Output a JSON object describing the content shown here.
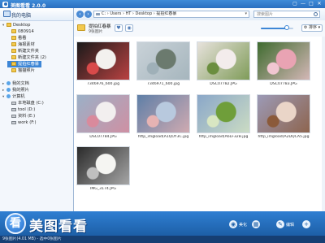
{
  "window": {
    "title": "美图看看 2.0.0",
    "buttons": [
      "▢",
      "—",
      "□",
      "✕"
    ]
  },
  "sidebar": {
    "computer_label": "我的电脑",
    "tree": [
      {
        "label": "Desktop",
        "icon": "folder",
        "expanded": true
      },
      {
        "label": "080914",
        "icon": "folder"
      },
      {
        "label": "看看",
        "icon": "folder"
      },
      {
        "label": "海报素材",
        "icon": "folder"
      },
      {
        "label": "新建文件夹",
        "icon": "folder"
      },
      {
        "label": "新建文件夹 (2)",
        "icon": "folder"
      },
      {
        "label": "提拍红春暴",
        "icon": "folder",
        "selected": true
      },
      {
        "label": "猫猫照片",
        "icon": "folder"
      },
      {
        "label": "我的文档",
        "icon": "special"
      },
      {
        "label": "我的照片",
        "icon": "special"
      },
      {
        "label": "计算机",
        "icon": "special",
        "expanded": true
      },
      {
        "label": "本地磁盘 (C:)",
        "icon": "drive"
      },
      {
        "label": "tool (D:)",
        "icon": "drive"
      },
      {
        "label": "资料 (E:)",
        "icon": "drive"
      },
      {
        "label": "work (F:)",
        "icon": "drive"
      }
    ]
  },
  "toolbar": {
    "back_icon": "‹",
    "forward_icon": "›",
    "address": "C: › Users › HT › Desktop › 提拍红春暴",
    "search_placeholder": "搜索图片"
  },
  "folder_header": {
    "name": "提拍红春暴",
    "count": "9张图片",
    "sort_label": "排序",
    "zoom_level": 0.8
  },
  "thumbnails": [
    {
      "caption": "7346976_600.jpg",
      "palette": [
        "#1a1a1a",
        "#f3f1ee",
        "#d94a4a"
      ]
    },
    {
      "caption": "7346971_600.jpg",
      "palette": [
        "#c9d2d8",
        "#6b7a6e",
        "#9fb0b8"
      ]
    },
    {
      "caption": "DSC07782.JPG",
      "palette": [
        "#e7e2dc",
        "#f3ecec",
        "#6b8e3f"
      ]
    },
    {
      "caption": "DSC07783.JPG",
      "palette": [
        "#3f6b2f",
        "#e9a3b3",
        "#f1c6d1"
      ]
    },
    {
      "caption": "DSC07784.JPG",
      "palette": [
        "#9bb0c7",
        "#f2efef",
        "#d98a9c"
      ]
    },
    {
      "caption": "http_imgload(A1QOY3C.jpg",
      "palette": [
        "#5f7fa7",
        "#b8c9de",
        "#e6b3b3"
      ]
    },
    {
      "caption": "http_imgload(A6LF32B.jpg",
      "palette": [
        "#8aa7c9",
        "#6f9e3a",
        "#d8e6c2"
      ]
    },
    {
      "caption": "http_imgload(A2DQCA5.jpg",
      "palette": [
        "#9c9ab6",
        "#ead5c8",
        "#8b5a3a"
      ]
    },
    {
      "caption": "IMG_3174.JPG",
      "palette": [
        "#2a2a2a",
        "#f5f5f2",
        "#bfbfbf"
      ]
    }
  ],
  "bottom_bar": {
    "brand_text": "美图看看",
    "brand_glyph": "看",
    "actions": [
      {
        "icon": "◉",
        "label": "美化"
      },
      {
        "icon": "▦",
        "label": ""
      },
      {
        "icon": "✎",
        "label": "编辑"
      },
      {
        "icon": "+",
        "label": ""
      }
    ]
  },
  "status": {
    "text": "9张图片(4.01 MB) - 选中0张图片"
  }
}
